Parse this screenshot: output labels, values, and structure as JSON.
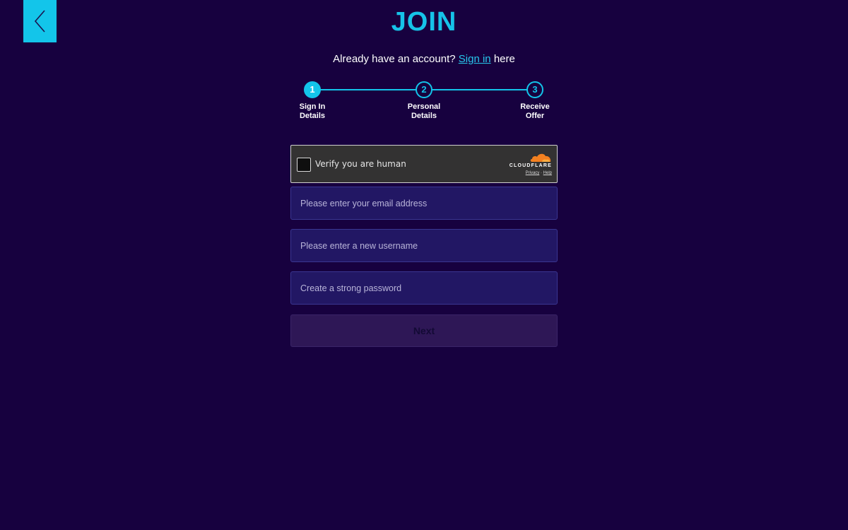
{
  "header": {
    "title": "JOIN",
    "back_icon": "chevron-left-icon"
  },
  "signin": {
    "prefix": "Already have an account?",
    "link": "Sign in",
    "suffix": "here"
  },
  "steps": [
    {
      "number": "1",
      "label": "Sign In\nDetails",
      "active": true
    },
    {
      "number": "2",
      "label": "Personal\nDetails",
      "active": false
    },
    {
      "number": "3",
      "label": "Receive\nOffer",
      "active": false
    }
  ],
  "captcha": {
    "label": "Verify you are human",
    "brand": "CLOUDFLARE",
    "privacy": "Privacy",
    "separator": "·",
    "help": "Help"
  },
  "form": {
    "email_placeholder": "Please enter your email address",
    "username_placeholder": "Please enter a new username",
    "password_placeholder": "Create a strong password",
    "next_label": "Next"
  },
  "colors": {
    "background": "#17013f",
    "accent": "#13c5ea",
    "input_bg": "#221764",
    "button_bg": "#2e1756"
  }
}
